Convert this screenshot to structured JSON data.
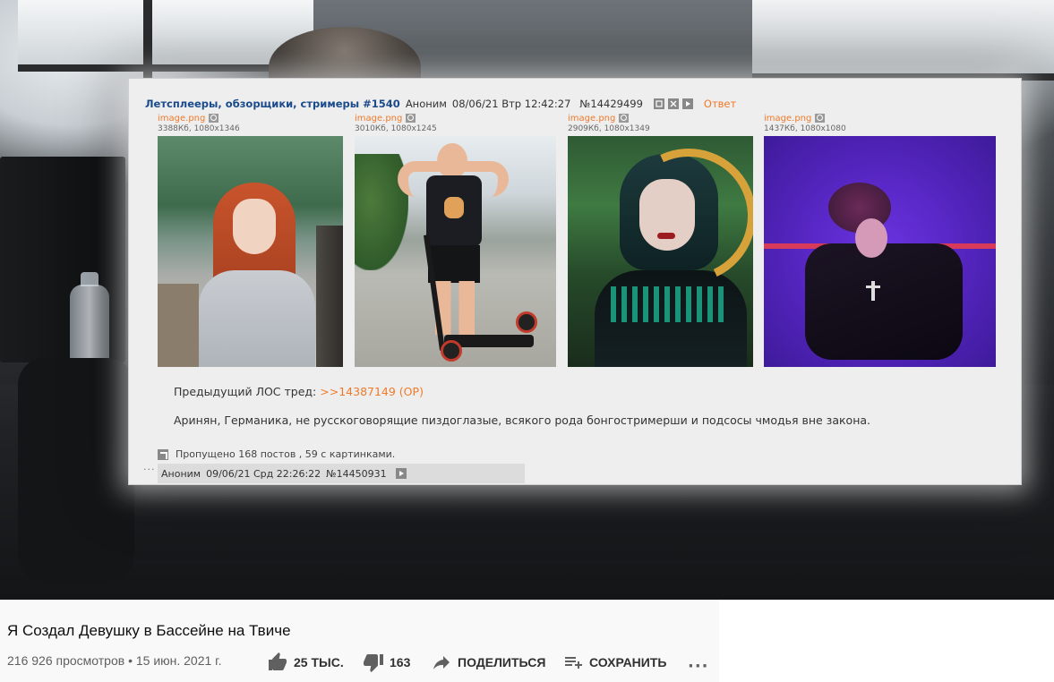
{
  "post": {
    "subject": "Летсплееры, обзорщики, стримеры #1540",
    "author": "Аноним",
    "date": "08/06/21 Втр 12:42:27",
    "number": "№14429499",
    "reply_label": "Ответ",
    "images": [
      {
        "name": "image.png",
        "meta": "3388Кб, 1080x1346"
      },
      {
        "name": "image.png",
        "meta": "3010Кб, 1080x1245"
      },
      {
        "name": "image.png",
        "meta": "2909Кб, 1080x1349"
      },
      {
        "name": "image.png",
        "meta": "1437Кб, 1080x1080"
      }
    ],
    "prev_thread_label": "Предыдущий ЛОС тред:",
    "prev_thread_link": ">>14387149 (OP)",
    "body": "Аринян, Германика, не русскоговорящие пиздоглазые, всякого рода бонгостримерши и подсосы чмодья вне закона.",
    "skipped": "Пропущено 168 постов , 59 с картинками.",
    "next_reply": {
      "dots": "···",
      "author": "Аноним",
      "date": "09/06/21 Срд 22:26:22",
      "number": "№14450931"
    }
  },
  "video": {
    "title": "Я Создал Девушку в Бассейне на Твиче",
    "meta": "216 926 просмотров • 15 июн. 2021 г.",
    "likes": "25 ТЫС.",
    "dislikes": "163",
    "share_label": "ПОДЕЛИТЬСЯ",
    "save_label": "СОХРАНИТЬ",
    "more": "···"
  },
  "colors": {
    "subject": "#1a4a8a",
    "link": "#f07a2a",
    "post_bg": "#eeeeee",
    "yt_text": "#0f0f0f",
    "yt_meta": "#606060"
  }
}
